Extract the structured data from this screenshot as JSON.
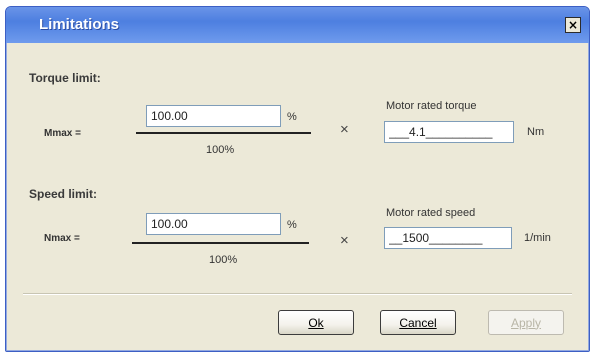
{
  "window": {
    "title": "Limitations",
    "close_glyph": "×"
  },
  "torque": {
    "section_title": "Torque limit:",
    "lhs_label": "Mmax =",
    "percent_value": "100.00",
    "percent_unit": "%",
    "denominator": "100%",
    "times_sign": "×",
    "rated_label": "Motor rated torque",
    "rated_value": "___4.1__________",
    "rated_unit": "Nm"
  },
  "speed": {
    "section_title": "Speed limit:",
    "lhs_label": "Nmax =",
    "percent_value": "100.00",
    "percent_unit": "%",
    "denominator": "100%",
    "times_sign": "×",
    "rated_label": "Motor rated speed",
    "rated_value": "__1500________",
    "rated_unit": "1/min"
  },
  "buttons": {
    "ok_label": "Ok",
    "cancel_label": "Cancel",
    "apply_label": "Apply"
  },
  "colors": {
    "titlebar": "#4d7fe0",
    "dialog_bg": "#ece9d8",
    "input_border": "#7f9db9"
  }
}
